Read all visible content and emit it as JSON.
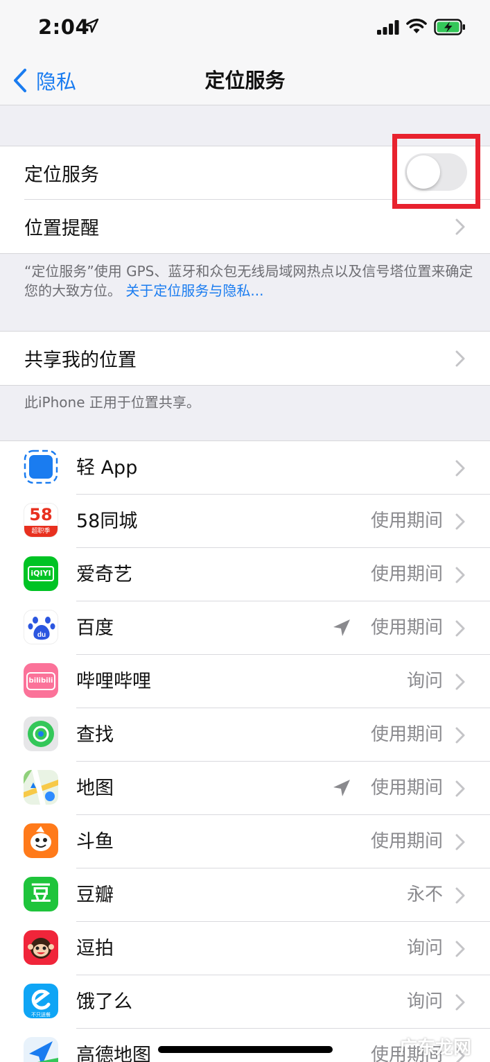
{
  "status": {
    "time": "2:04"
  },
  "nav": {
    "back_label": "隐私",
    "title": "定位服务"
  },
  "location_services": {
    "label": "定位服务",
    "enabled": false
  },
  "location_alerts": {
    "label": "位置提醒"
  },
  "footnote_location": {
    "text": "“定位服务”使用 GPS、蓝牙和众包无线局域网热点以及信号塔位置来确定您的大致方位。",
    "link": "关于定位服务与隐私..."
  },
  "share_location": {
    "label": "共享我的位置"
  },
  "footnote_share": {
    "text": "此iPhone 正用于位置共享。"
  },
  "apps": [
    {
      "name": "轻 App",
      "permission": "",
      "recent_location": false,
      "icon": "app-clip-icon"
    },
    {
      "name": "58同城",
      "permission": "使用期间",
      "recent_location": false,
      "icon": "58-icon"
    },
    {
      "name": "爱奇艺",
      "permission": "使用期间",
      "recent_location": false,
      "icon": "iqiyi-icon"
    },
    {
      "name": "百度",
      "permission": "使用期间",
      "recent_location": true,
      "icon": "baidu-icon"
    },
    {
      "name": "哔哩哔哩",
      "permission": "询问",
      "recent_location": false,
      "icon": "bilibili-icon"
    },
    {
      "name": "查找",
      "permission": "使用期间",
      "recent_location": false,
      "icon": "find-my-icon"
    },
    {
      "name": "地图",
      "permission": "使用期间",
      "recent_location": true,
      "icon": "maps-icon"
    },
    {
      "name": "斗鱼",
      "permission": "使用期间",
      "recent_location": false,
      "icon": "douyu-icon"
    },
    {
      "name": "豆瓣",
      "permission": "永不",
      "recent_location": false,
      "icon": "douban-icon"
    },
    {
      "name": "逗拍",
      "permission": "询问",
      "recent_location": false,
      "icon": "doupai-icon"
    },
    {
      "name": "饿了么",
      "permission": "询问",
      "recent_location": false,
      "icon": "eleme-icon"
    },
    {
      "name": "高德地图",
      "permission": "使用期间",
      "recent_location": false,
      "icon": "amap-icon"
    }
  ],
  "icon_texts": {
    "58": "58",
    "58_sub": "超职季",
    "iqiyi": "iQIYI",
    "baidu": "du",
    "bilibili": "bilibili",
    "douban": "豆",
    "eleme_sub": "不只送餐"
  },
  "watermark": "广东龙网",
  "colors": {
    "accent": "#1a7cf0",
    "highlight": "#e8222e"
  }
}
